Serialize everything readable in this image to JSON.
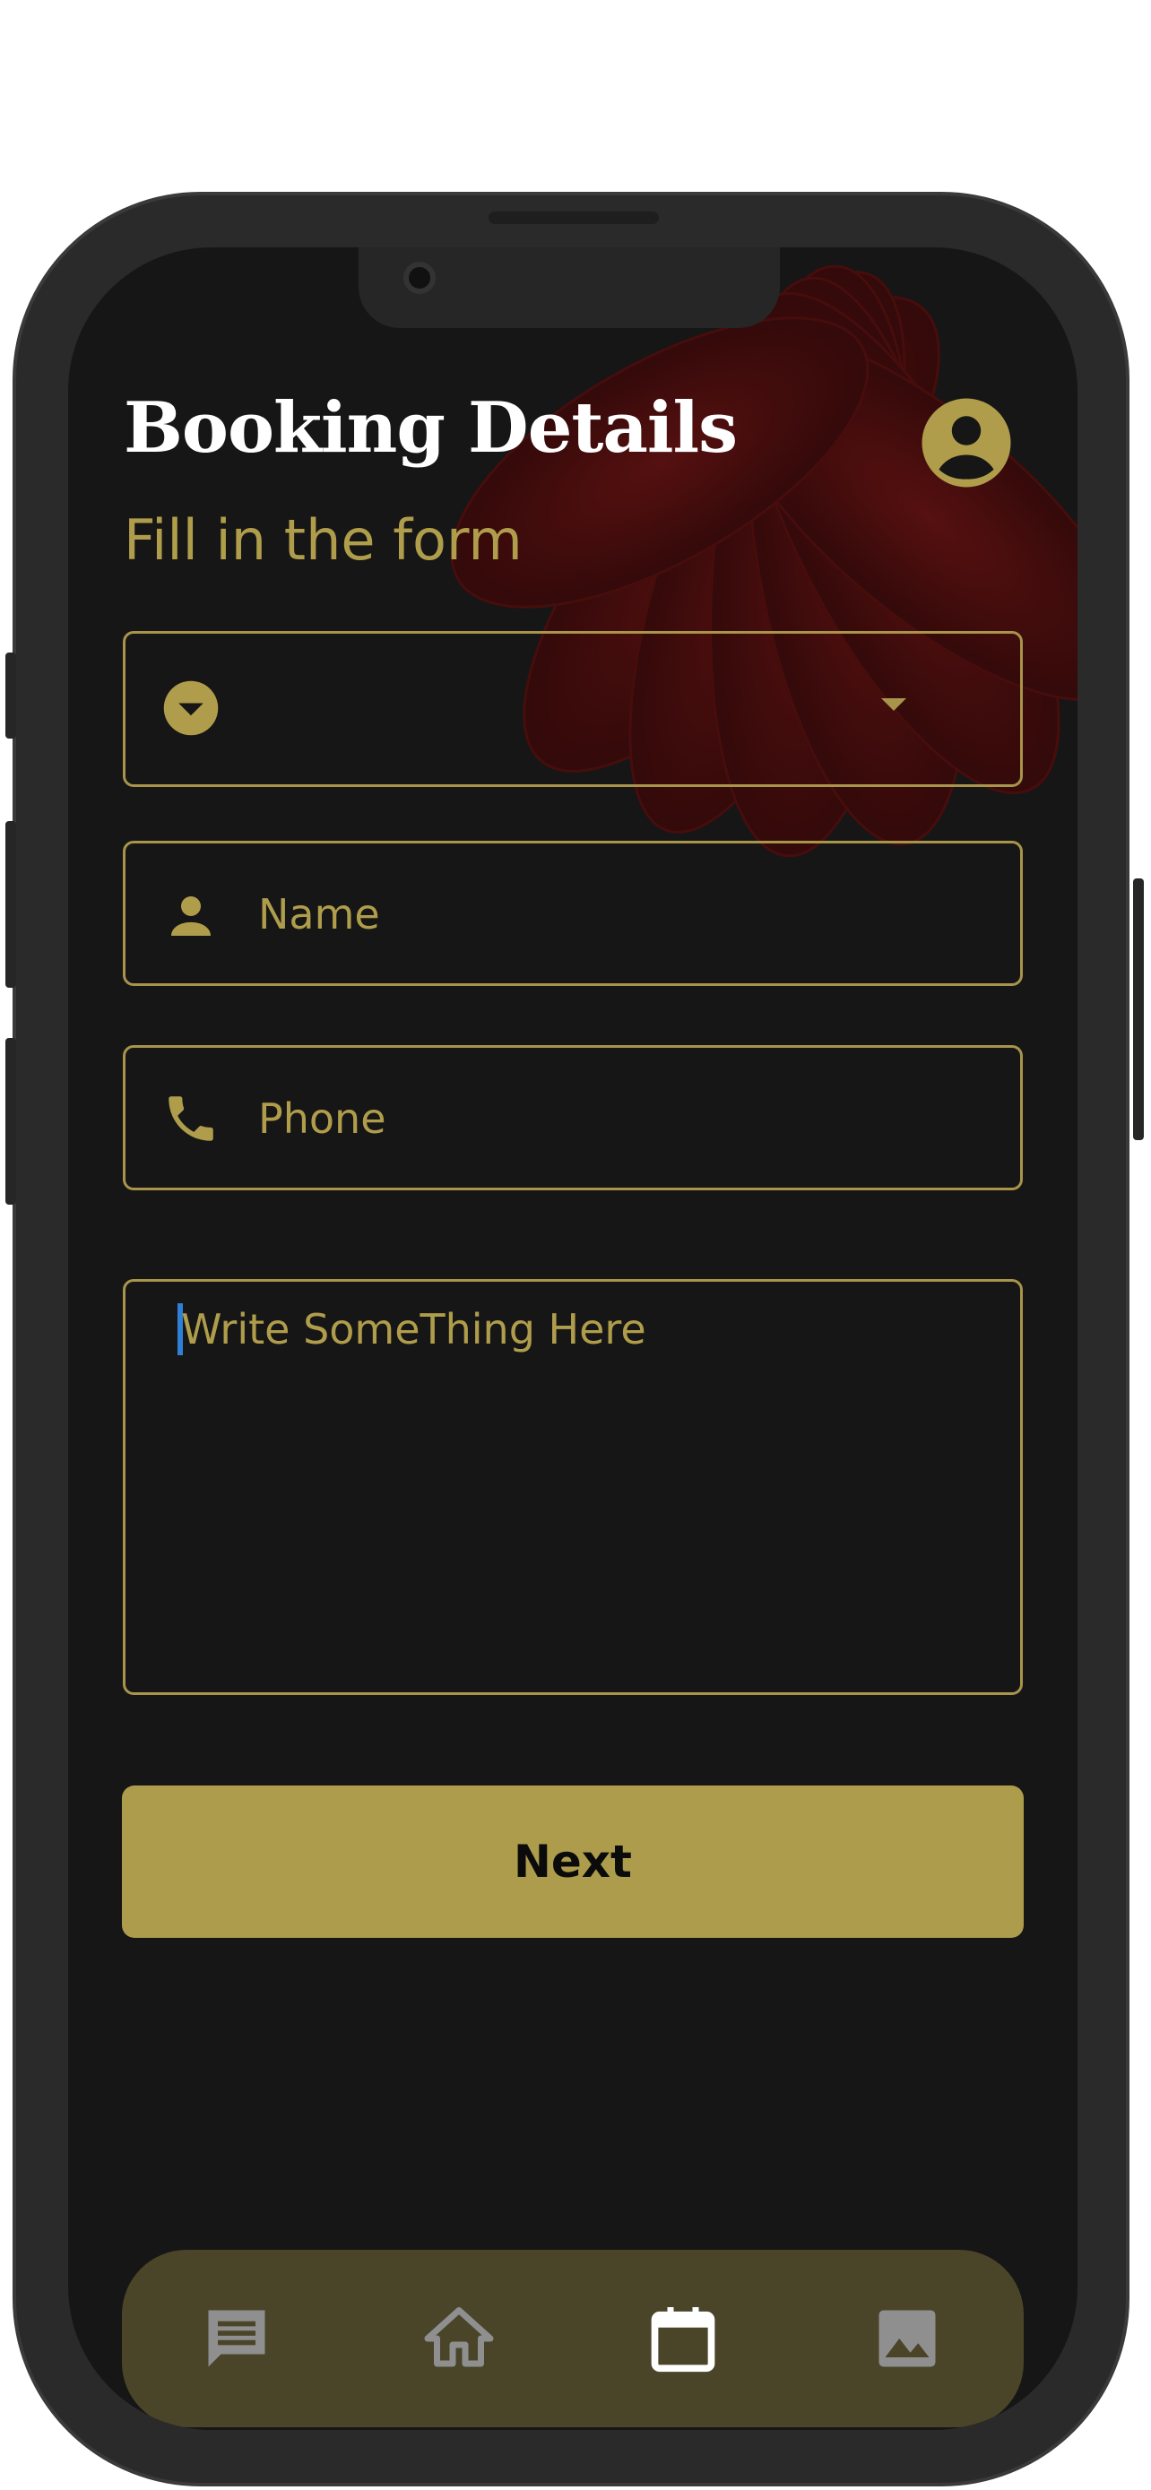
{
  "header": {
    "title": "Booking Details",
    "subtitle": "Fill in the form"
  },
  "form": {
    "dropdown": {
      "value": ""
    },
    "name": {
      "placeholder": "Name"
    },
    "phone": {
      "placeholder": "Phone"
    },
    "message": {
      "placeholder": "Write SomeThing Here"
    }
  },
  "actions": {
    "next_label": "Next"
  },
  "bottom_nav": {
    "items": [
      {
        "icon": "message-icon",
        "active": false
      },
      {
        "icon": "home-icon",
        "active": false
      },
      {
        "icon": "calendar-icon",
        "active": true
      },
      {
        "icon": "image-icon",
        "active": false
      }
    ]
  },
  "colors": {
    "background": "#161616",
    "accent": "#ad9c4b",
    "nav_background": "#4a4429",
    "cursor": "#2f7fd8"
  }
}
